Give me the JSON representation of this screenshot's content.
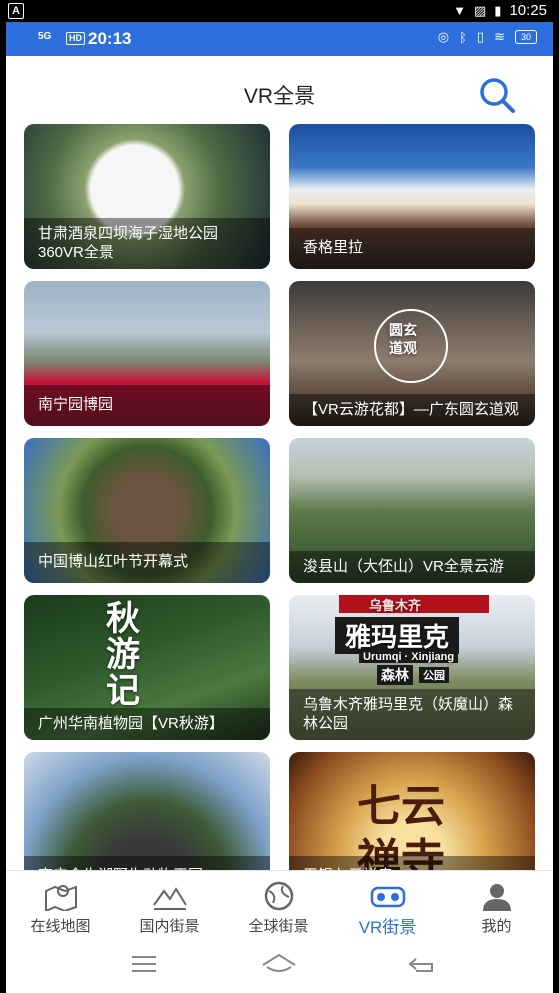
{
  "system_bar": {
    "app_icon_letter": "A",
    "time": "10:25"
  },
  "phone_status": {
    "network": "5G",
    "hd": "HD",
    "time": "20:13",
    "battery": "30"
  },
  "header": {
    "title": "VR全景"
  },
  "cards": [
    {
      "caption": "甘肃酒泉四坝海子湿地公园360VR全景"
    },
    {
      "caption": "香格里拉"
    },
    {
      "caption": "南宁园博园"
    },
    {
      "caption": "【VR云游花都】—广东圆玄道观",
      "seal_text": "圆玄道观"
    },
    {
      "caption": "中国博山红叶节开幕式"
    },
    {
      "caption": "浚县山（大伾山）VR全景云游"
    },
    {
      "caption": "广州华南植物园【VR秋游】",
      "art_text": "秋游记"
    },
    {
      "caption": "乌鲁木齐雅玛里克（妖魔山）森林公园",
      "art_title": "雅玛里克",
      "art_sub": "Urumqi · Xinjiang",
      "art_forest": "森林",
      "art_park": "公园",
      "art_top": "乌鲁木齐"
    },
    {
      "caption": "南宁金牛湖野生动物王国"
    },
    {
      "caption": "无锡七云禅寺",
      "art_line1": "七云",
      "art_line2": "禅寺"
    }
  ],
  "tabs": [
    {
      "label": "在线地图",
      "icon": "map-icon"
    },
    {
      "label": "国内街景",
      "icon": "mountain-icon"
    },
    {
      "label": "全球街景",
      "icon": "globe-icon"
    },
    {
      "label": "VR街景",
      "icon": "vr-headset-icon",
      "active": true
    },
    {
      "label": "我的",
      "icon": "user-icon"
    }
  ],
  "colors": {
    "accent": "#2d6fdc",
    "status_bar": "#2d6fdc"
  }
}
